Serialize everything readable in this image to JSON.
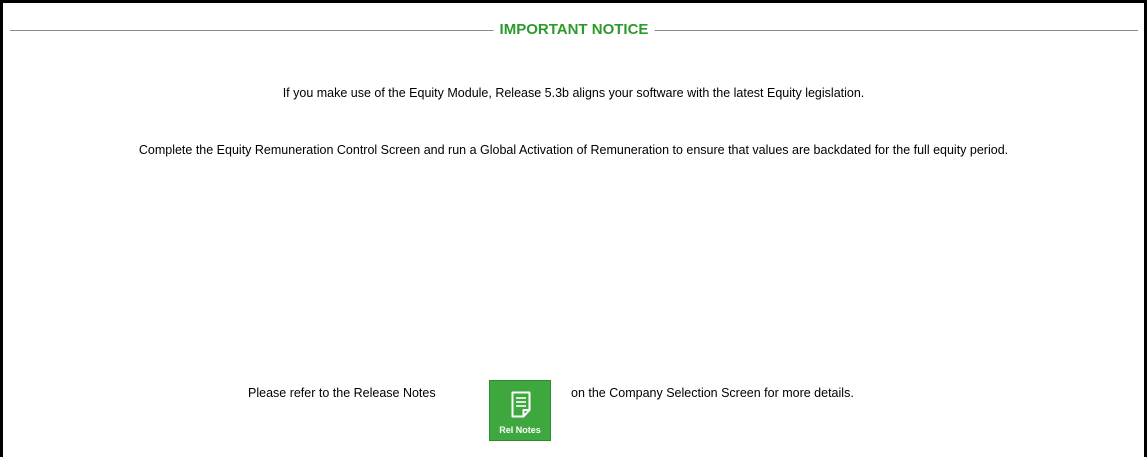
{
  "notice": {
    "title": "IMPORTANT NOTICE",
    "paragraph1": "If you make use of the Equity Module, Release 5.3b aligns your software with the latest Equity legislation.",
    "paragraph2": "Complete the Equity Remuneration Control Screen and run a Global Activation of Remuneration to ensure that values are backdated for the full equity period."
  },
  "footer": {
    "text_before": "Please refer to the Release Notes",
    "text_after": "on the Company Selection Screen for more details.",
    "button_label": "Rel Notes",
    "button_icon": "document-icon"
  },
  "colors": {
    "title_green": "#2d9a2d",
    "button_green": "#3ea83e"
  }
}
